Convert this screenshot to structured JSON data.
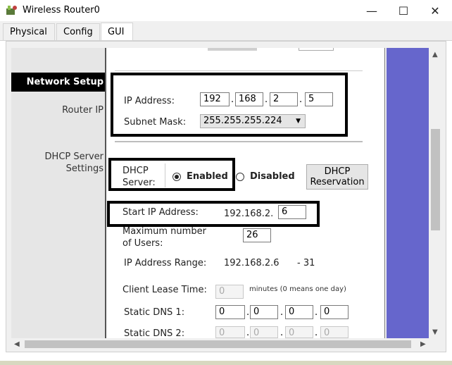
{
  "window": {
    "title": "Wireless Router0",
    "minimize": "—",
    "maximize": "☐",
    "close": "✕"
  },
  "tabs": [
    {
      "label": "Physical"
    },
    {
      "label": "Config"
    },
    {
      "label": "GUI",
      "active": true
    }
  ],
  "sidebar": {
    "network_setup": "Network Setup",
    "router_ip": "Router IP",
    "dhcp_server_settings_1": "DHCP Server",
    "dhcp_server_settings_2": "Settings"
  },
  "router_ip": {
    "ip_label": "IP Address:",
    "ip": [
      "192",
      "168",
      "2",
      "5"
    ],
    "mask_label": "Subnet Mask:",
    "mask_value": "255.255.255.224"
  },
  "dhcp": {
    "server_label_1": "DHCP",
    "server_label_2": "Server:",
    "enabled_label": "Enabled",
    "disabled_label": "Disabled",
    "selected": "Enabled",
    "reservation_1": "DHCP",
    "reservation_2": "Reservation",
    "start_ip_label": "Start IP Address:",
    "start_ip_prefix": "192.168.2.",
    "start_ip_last": "6",
    "max_users_label_1": "Maximum number",
    "max_users_label_2": "of Users:",
    "max_users": "26",
    "range_label": "IP Address Range:",
    "range_start": "192.168.2.6",
    "range_end": "- 31",
    "lease_label": "Client Lease Time:",
    "lease_value": "0",
    "lease_hint": "minutes (0 means one day)",
    "dns1_label": "Static DNS 1:",
    "dns1": [
      "0",
      "0",
      "0",
      "0"
    ],
    "dns2_label": "Static DNS 2:",
    "dns2": [
      "0",
      "0",
      "0",
      "0"
    ]
  }
}
